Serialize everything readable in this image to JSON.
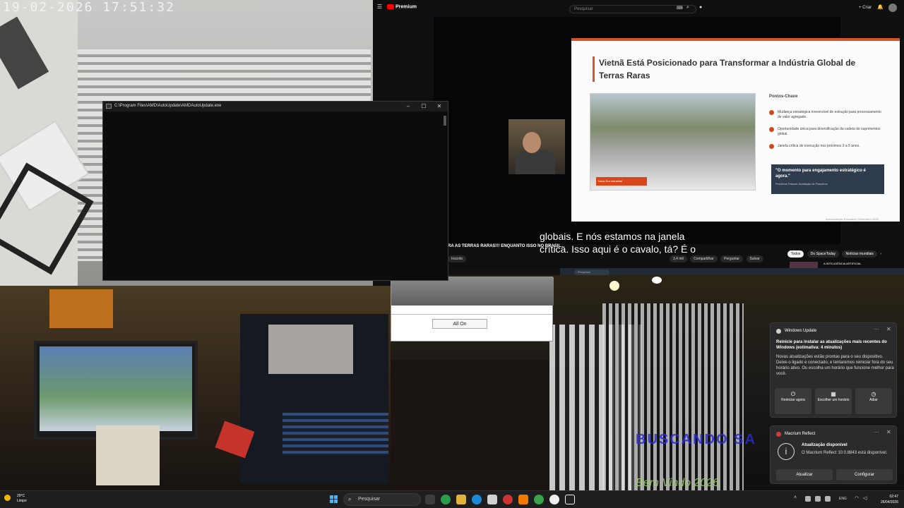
{
  "camera": {
    "timestamp": "19-02-2026 17:51:32",
    "graffiti_text": "BUSCANDO SA",
    "welcome_text": "Bem Vindo 2026"
  },
  "console_window": {
    "title": "C:\\Program Files\\AMD\\AutoUpdate\\AMDAutoUpdate.exe",
    "controls": [
      "–",
      "☐",
      "✕"
    ]
  },
  "youtube": {
    "logo": "Premium",
    "search_placeholder": "Pesquisar",
    "create_label": "+ Criar",
    "slide": {
      "title": "Vietnã Está Posicionado para Transformar a Indústria Global de Terras Raras",
      "photo_tag": "Nova Era Industrial",
      "key_heading": "Pontos-Chave",
      "bullets": [
        "Mudança estratégica irreversível de extração para processamento de valor agregado.",
        "Oportunidade única para diversificação da cadeia de suprimentos global.",
        "Janela crítica de execução nos próximos 3 a 5 anos."
      ],
      "quote": "\"O momento para engajamento estratégico é agora.\"",
      "quote_sub": "Próximos Passos: Avaliação de Parceiros",
      "footer": "Apresentação Executiva | Dezembro 2025"
    },
    "subtitle_line1": "globais. E nós estamos na janela",
    "subtitle_line2": "crítica. Isso aqui é o cavalo, tá? É o",
    "video_title": "RA AS TERRAS RARAS!!! ENQUANTO ISSO NO BRASIL...",
    "subscribe": "Inscrito",
    "actions": [
      "3,4 mil",
      "Compartilhar",
      "Perguntar",
      "Salvar"
    ],
    "chips": [
      "Todos",
      "Do SpaceToday",
      "Notícias mundiais"
    ],
    "related_title": "A INTELIGÊNCIA ARTIFICIAL",
    "mini_taskbar_search": "Pesquisar"
  },
  "dialog": {
    "button": "All On"
  },
  "notifications": {
    "windows_update": {
      "app": "Windows Update",
      "title": "Reinicie para instalar as atualizações mais recentes do Windows (estimativa: 4 minutos)",
      "body": "Novas atualizações estão prontas para o seu dispositivo. Deixe-o ligado e conectado, e tentaremos reiniciar fora do seu horário ativo. Ou escolha um horário que funcione melhor para você.",
      "buttons": [
        "Reiniciar agora",
        "Escolher um horário",
        "Adiar"
      ]
    },
    "macrium": {
      "app": "Macrium Reflect",
      "title": "Atualização disponível",
      "body": "O Macrium Reflect 10.0.8843 está disponível.",
      "buttons": [
        "Atualizar",
        "Configurar"
      ]
    }
  },
  "taskbar": {
    "weather_temp": "29°C",
    "weather_desc": "Limpo",
    "search": "Pesquisar",
    "lang": "ENG",
    "time": "02:47",
    "date": "26/04/2026"
  }
}
